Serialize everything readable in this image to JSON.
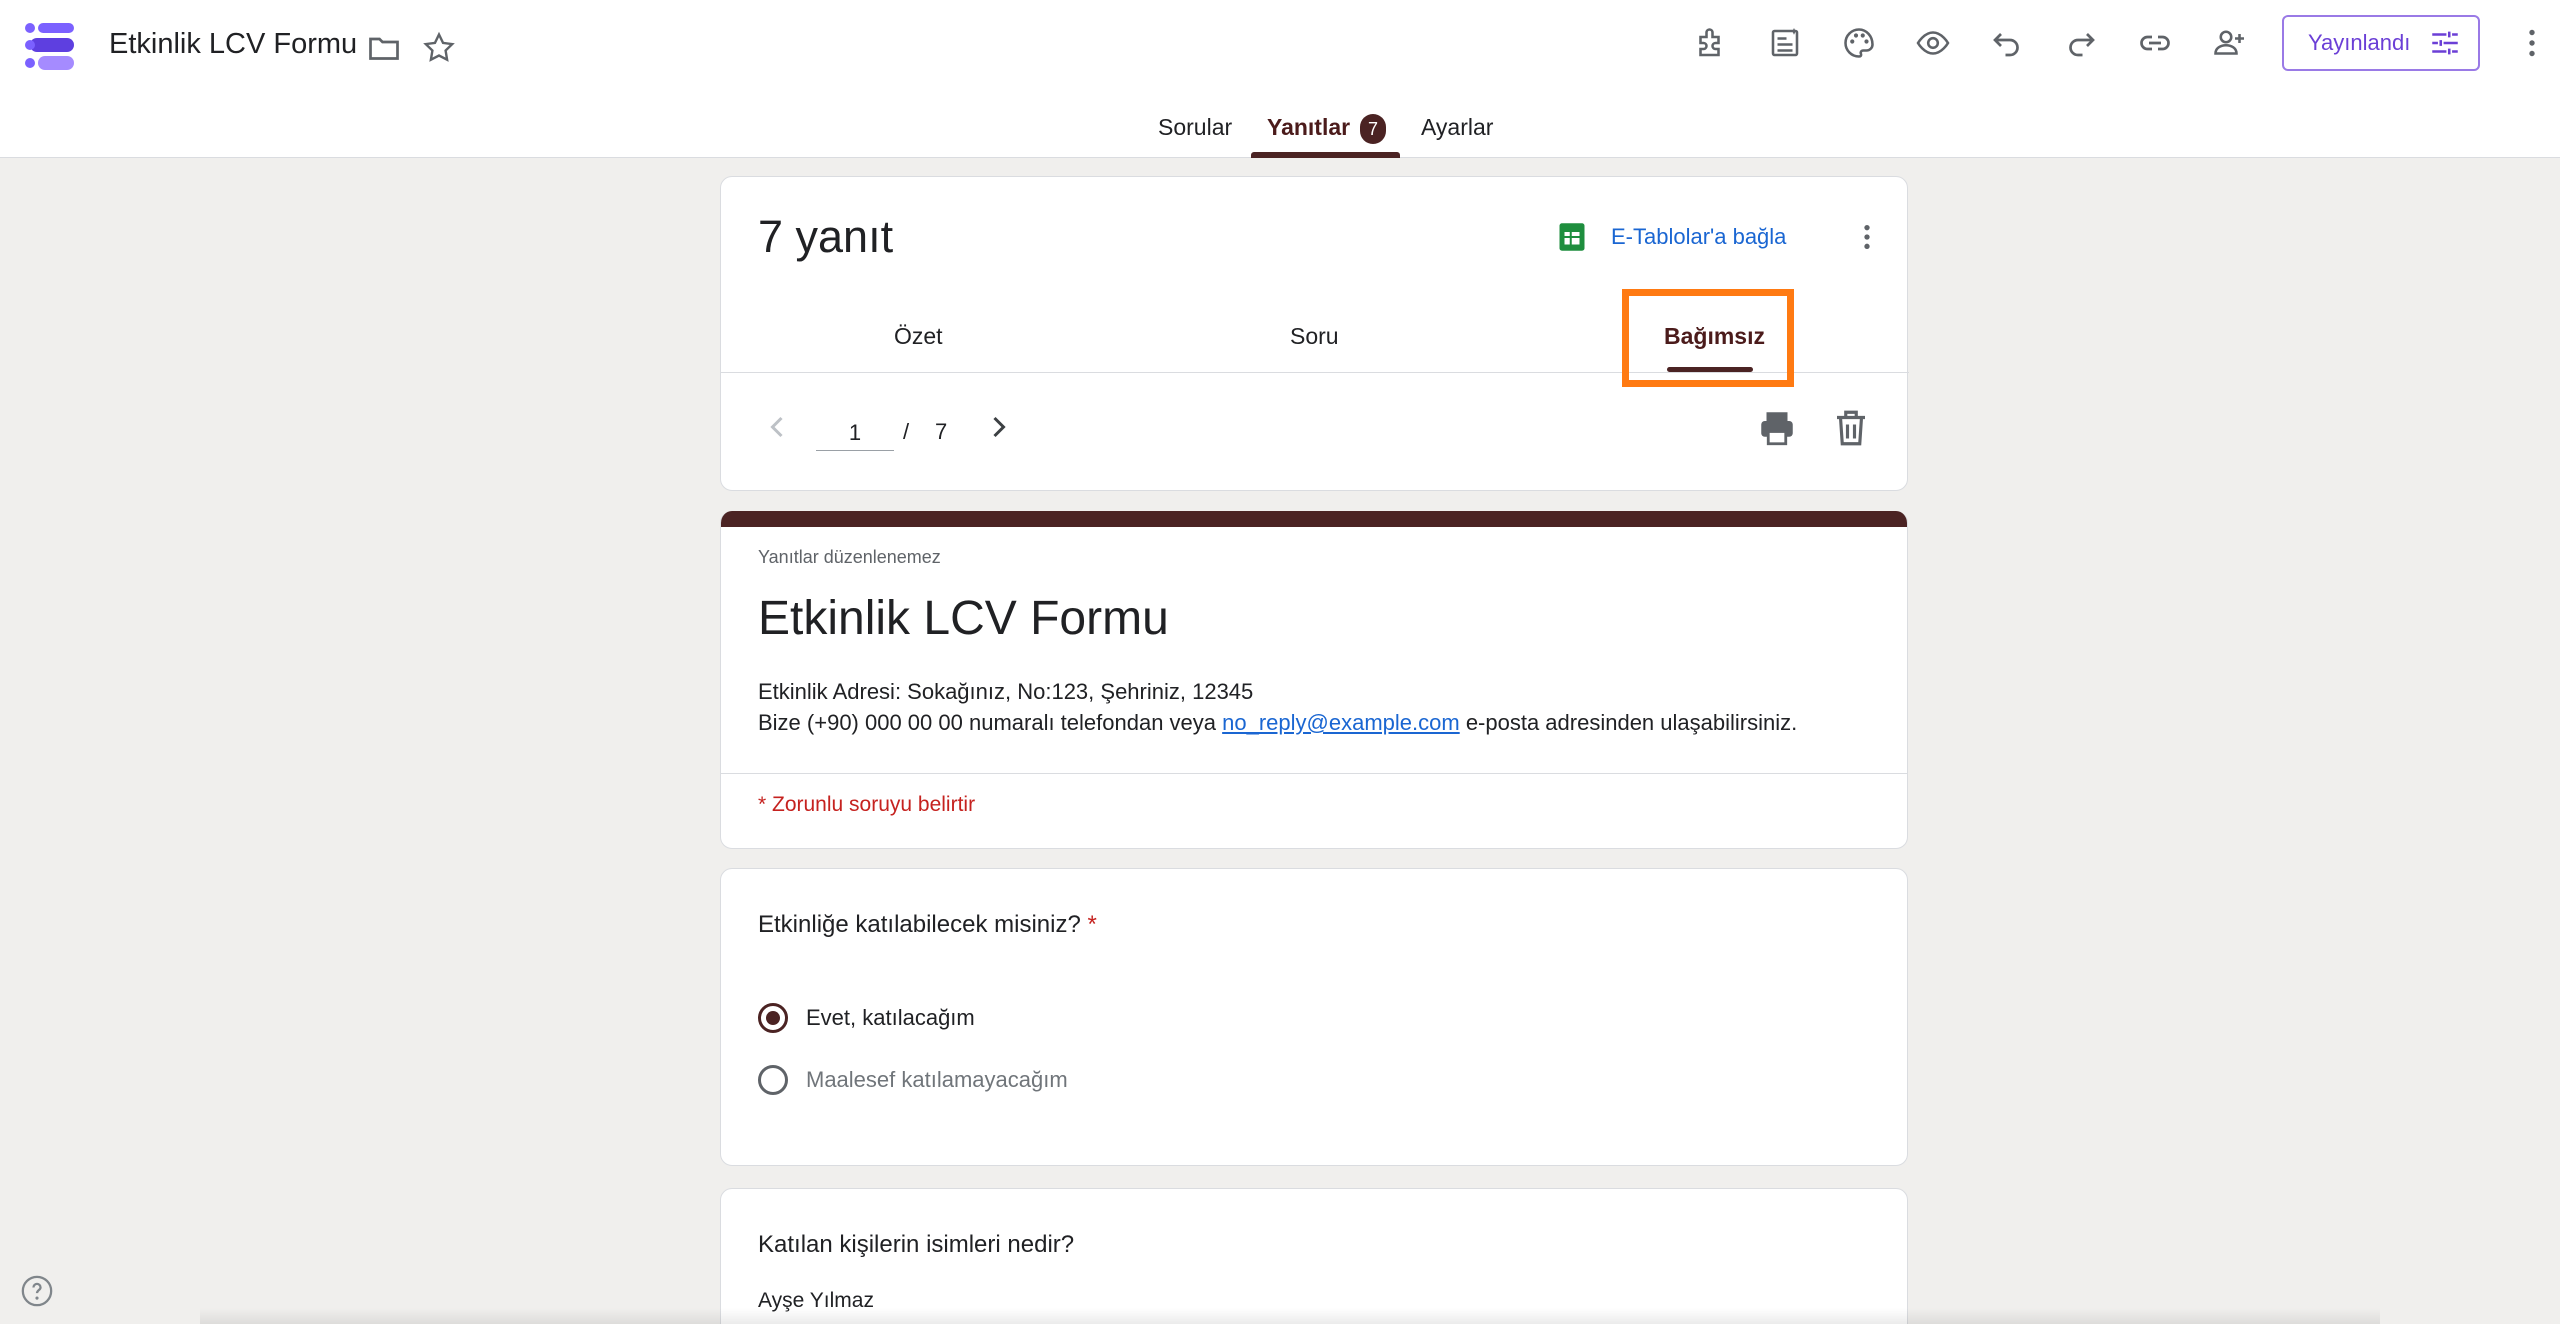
{
  "app": {
    "doc_title": "Etkinlik LCV Formu",
    "publish_label": "Yayınlandı",
    "brand_color": "#4b2323",
    "accent_color": "#6b3fd6",
    "header_icons": [
      "folder-icon",
      "star-icon",
      "addons-icon",
      "ai-icon",
      "palette-icon",
      "preview-icon",
      "undo-icon",
      "redo-icon",
      "link-icon",
      "add-person-icon",
      "more-vert-icon"
    ]
  },
  "tabs": {
    "questions": "Sorular",
    "responses": "Yanıtlar",
    "responses_badge": "7",
    "settings": "Ayarlar",
    "active": "responses"
  },
  "responses": {
    "count_label": "7 yanıt",
    "sheets_link": "E-Tablolar'a bağla",
    "subtabs": [
      "Özet",
      "Soru",
      "Bağımsız"
    ],
    "active_subtab": "Bağımsız",
    "current_page": "1",
    "page_sep": "/",
    "total_pages": "7"
  },
  "form": {
    "no_edit_note": "Yanıtlar düzenlenemez",
    "title": "Etkinlik LCV Formu",
    "desc_line1": "Etkinlik Adresi: Sokağınız, No:123, Şehriniz, 12345",
    "desc_line2_pre": "Bize (+90) 000 00 00 numaralı telefondan veya ",
    "desc_email": "no_reply@example.com",
    "desc_line2_post": " e-posta adresinden ulaşabilirsiniz.",
    "required_note": "* Zorunlu soruyu belirtir"
  },
  "questions": {
    "q1": {
      "title": "Etkinliğe katılabilecek misiniz?",
      "required_star": "*",
      "options": [
        "Evet, katılacağım",
        "Maalesef katılamayacağım"
      ],
      "selected": "Evet, katılacağım"
    },
    "q2": {
      "title": "Katılan kişilerin isimleri nedir?",
      "answer": "Ayşe Yılmaz"
    }
  }
}
